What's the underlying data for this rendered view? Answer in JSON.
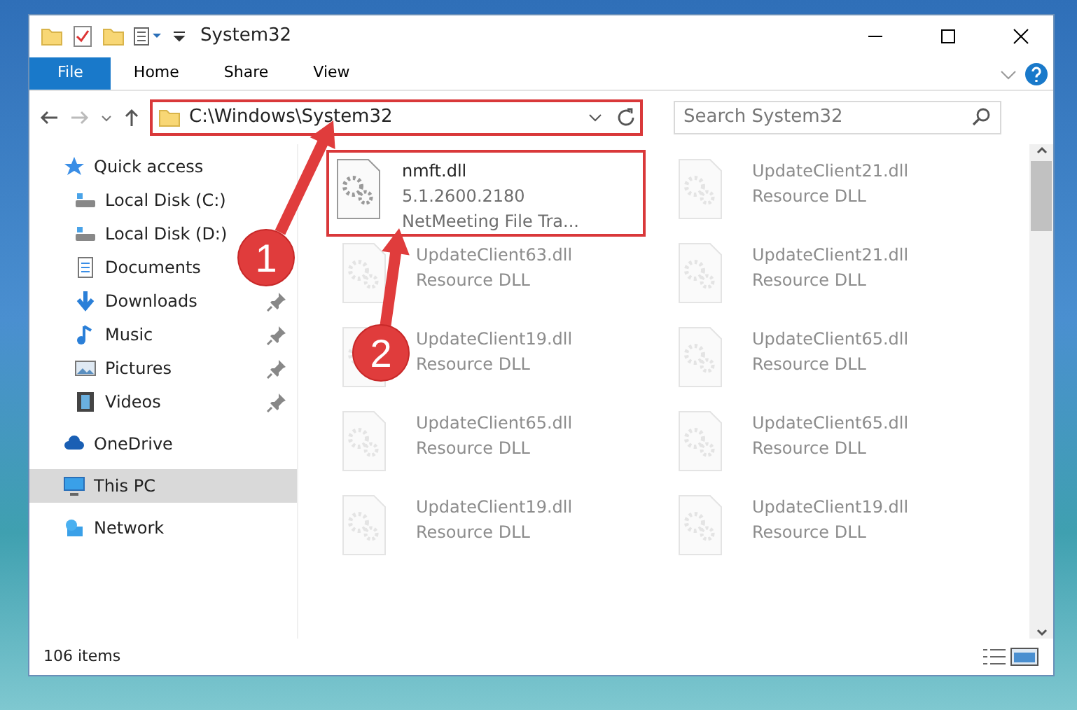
{
  "window": {
    "title": "System32"
  },
  "ribbon_tabs": [
    {
      "label": "File",
      "kind": "file"
    },
    {
      "label": "Home",
      "kind": "tab"
    },
    {
      "label": "Share",
      "kind": "tab"
    },
    {
      "label": "View",
      "kind": "tab"
    }
  ],
  "address_bar": {
    "path": "C:\\Windows\\System32"
  },
  "search": {
    "placeholder": "Search System32"
  },
  "sidebar": {
    "items": [
      {
        "label": "Quick access",
        "kind": "star",
        "selected": false,
        "children": [
          {
            "label": "Local Disk (C:)",
            "kind": "drive",
            "pinned": false
          },
          {
            "label": "Local Disk (D:)",
            "kind": "drive",
            "pinned": false
          },
          {
            "label": "Documents",
            "kind": "documents",
            "pinned": false
          },
          {
            "label": "Downloads",
            "kind": "downloads",
            "pinned": true
          },
          {
            "label": "Music",
            "kind": "music",
            "pinned": true
          },
          {
            "label": "Pictures",
            "kind": "pictures",
            "pinned": true
          },
          {
            "label": "Videos",
            "kind": "videos",
            "pinned": true
          }
        ]
      },
      {
        "label": "OneDrive",
        "kind": "cloud",
        "selected": false
      },
      {
        "label": "This PC",
        "kind": "pc",
        "selected": true
      },
      {
        "label": "Network",
        "kind": "network",
        "selected": false
      }
    ]
  },
  "files": [
    {
      "name": "nmft.dll",
      "lines": [
        "5.1.2600.2180",
        "NetMeeting File Tra..."
      ],
      "blurred": false
    },
    {
      "name": "UpdateClient21.dll",
      "lines": [
        "Resource DLL"
      ],
      "blurred": true
    },
    {
      "name": "UpdateClient63.dll",
      "lines": [
        "Resource DLL"
      ],
      "blurred": true
    },
    {
      "name": "UpdateClient21.dll",
      "lines": [
        "Resource DLL"
      ],
      "blurred": true
    },
    {
      "name": "UpdateClient19.dll",
      "lines": [
        "Resource DLL"
      ],
      "blurred": true
    },
    {
      "name": "UpdateClient65.dll",
      "lines": [
        "Resource DLL"
      ],
      "blurred": true
    },
    {
      "name": "UpdateClient65.dll",
      "lines": [
        "Resource DLL"
      ],
      "blurred": true
    },
    {
      "name": "UpdateClient65.dll",
      "lines": [
        "Resource DLL"
      ],
      "blurred": true
    },
    {
      "name": "UpdateClient19.dll",
      "lines": [
        "Resource DLL"
      ],
      "blurred": true
    },
    {
      "name": "UpdateClient19.dll",
      "lines": [
        "Resource DLL"
      ],
      "blurred": true
    }
  ],
  "annotations": [
    {
      "label": "1"
    },
    {
      "label": "2"
    }
  ],
  "status_bar": {
    "item_count": "106 items"
  }
}
